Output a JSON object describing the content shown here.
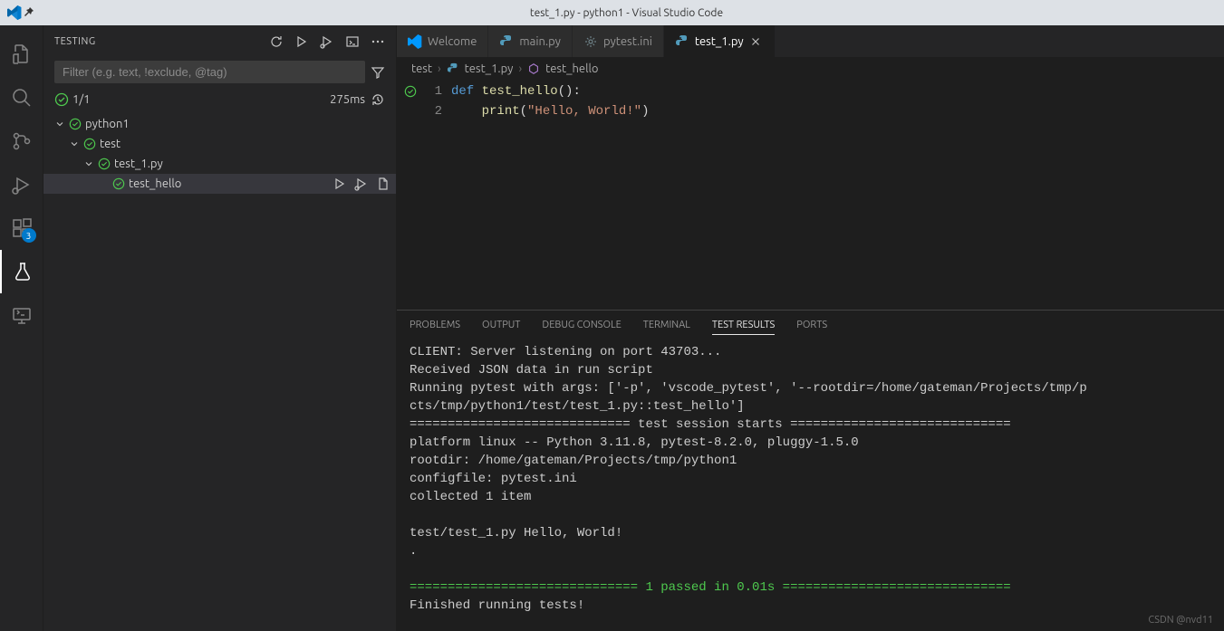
{
  "titlebar": {
    "title": "test_1.py - python1 - Visual Studio Code"
  },
  "activity": {
    "ext_badge": "3"
  },
  "sidebar": {
    "title": "TESTING",
    "filter_placeholder": "Filter (e.g. text, !exclude, @tag)",
    "status_count": "1/1",
    "status_time": "275ms",
    "tree": {
      "root": "python1",
      "folder": "test",
      "file": "test_1.py",
      "test": "test_hello"
    }
  },
  "tabs": [
    {
      "label": "Welcome"
    },
    {
      "label": "main.py"
    },
    {
      "label": "pytest.ini"
    },
    {
      "label": "test_1.py"
    }
  ],
  "breadcrumb": {
    "p0": "test",
    "p1": "test_1.py",
    "p2": "test_hello"
  },
  "editor": {
    "line1": "1",
    "line2": "2"
  },
  "code": {
    "kw_def": "def",
    "fn_name": "test_hello",
    "parens": "():",
    "indent": "    ",
    "print_name": "print",
    "open_paren": "(",
    "string": "\"Hello, World!\"",
    "close_paren": ")"
  },
  "panel": {
    "tabs": {
      "problems": "PROBLEMS",
      "output": "OUTPUT",
      "debug": "DEBUG CONSOLE",
      "terminal": "TERMINAL",
      "results": "TEST RESULTS",
      "ports": "PORTS"
    },
    "output": "CLIENT: Server listening on port 43703...\nReceived JSON data in run script\nRunning pytest with args: ['-p', 'vscode_pytest', '--rootdir=/home/gateman/Projects/tmp/p\ncts/tmp/python1/test/test_1.py::test_hello']\n============================= test session starts =============================\nplatform linux -- Python 3.11.8, pytest-8.2.0, pluggy-1.5.0\nrootdir: /home/gateman/Projects/tmp/python1\nconfigfile: pytest.ini\ncollected 1 item\n\ntest/test_1.py Hello, World!\n.\n\n",
    "pass_line": "============================== 1 passed in 0.01s ==============================",
    "finished": "\nFinished running tests!"
  },
  "watermark": "CSDN @nvd11"
}
